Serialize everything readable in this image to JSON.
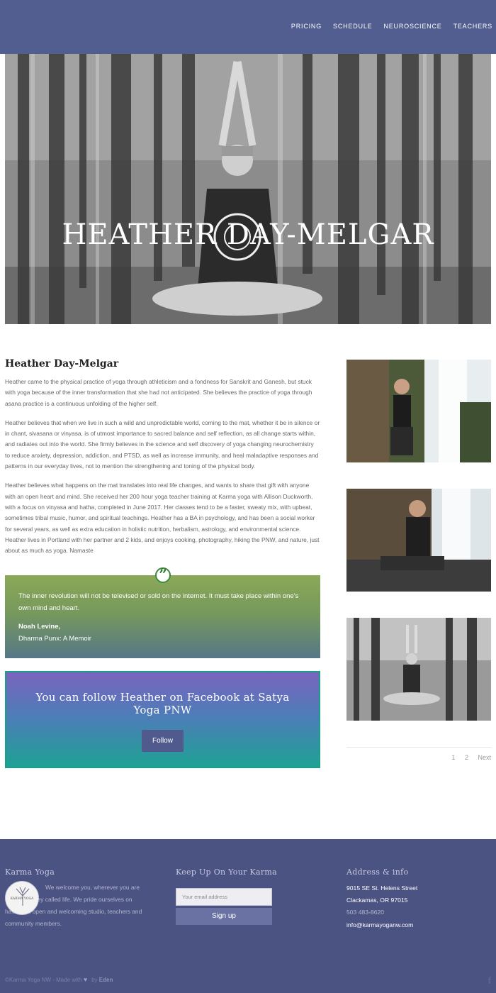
{
  "nav": {
    "items": [
      "PRICING",
      "SCHEDULE",
      "NEUROSCIENCE",
      "TEACHERS"
    ]
  },
  "hero": {
    "title": "HEATHER DAY-MELGAR"
  },
  "bio": {
    "title": "Heather Day-Melgar",
    "paragraphs": [
      "Heather came to the physical practice of yoga through athleticism and a fondness for Sanskrit and Ganesh, but stuck with yoga because of the inner transformation that she had not anticipated. She believes the practice of yoga through asana practice is a continuous unfolding of the higher self.",
      "Heather believes that when we live in such a wild and unpredictable world, coming to the mat, whether it be in silence or in chant, sivasana or vinyasa, is of utmost importance to sacred balance and self reflection, as all change starts within, and radiates out into the world. She firmly believes in the science and self discovery of yoga changing neurochemistry to reduce anxiety, depression, addiction, and PTSD, as well as increase immunity, and heal maladaptive responses and patterns in our everyday lives, not to mention the strengthening and toning of the physical body.",
      "Heather believes what happens on the mat translates into real life changes, and wants to share that gift with anyone with an open heart and mind. She received her 200 hour yoga teacher training at Karma yoga with Allison Duckworth, with a focus on vinyasa and hatha, completed in June 2017. Her classes tend to be a faster, sweaty mix, with upbeat, sometimes tribal music, humor, and spiritual teachings. Heather has a BA in psychology, and has been a social worker for several years, as well as extra education in holistic nutrition, herbalism, astrology, and environmental science. Heather lives in Portland with her partner and 2 kids, and enjoys cooking, photography, hiking the PNW, and nature, just about as much as yoga. Namaste"
    ]
  },
  "quote": {
    "icon": "quote-icon",
    "text": "The inner revolution will not be televised or sold on the internet. It must take place within one’s own mind and heart.",
    "author": "Noah Levine,",
    "source": "Dharma Punx: A Memoir"
  },
  "follow": {
    "text": "You can follow Heather on Facebook at Satya Yoga PNW",
    "button": "Follow"
  },
  "pager": {
    "pages": [
      "1",
      "2"
    ],
    "next": "Next"
  },
  "footer": {
    "about": {
      "heading": "Karma Yoga",
      "logo_text": "KARMA YOGA",
      "text": "We welcome you, wherever you are on this journey called life. We pride ourselves on having an open and welcoming studio, teachers and community members."
    },
    "newsletter": {
      "heading": "Keep Up On Your Karma",
      "placeholder": "Your email address",
      "button": "Sign up"
    },
    "address": {
      "heading": "Address & info",
      "street": "9015 SE St. Helens Street",
      "city": "Clackamas, OR 97015",
      "phone": "503 483-8620",
      "email": "info@karmayoganw.com"
    },
    "copyright_prefix": "©Karma Yoga NW - Made with",
    "copyright_by": "by",
    "copyright_brand": "Eden",
    "social_icon": "facebook-icon"
  },
  "colors": {
    "header": "#535e90",
    "footer": "#4b5382",
    "button": "#505a8c"
  }
}
